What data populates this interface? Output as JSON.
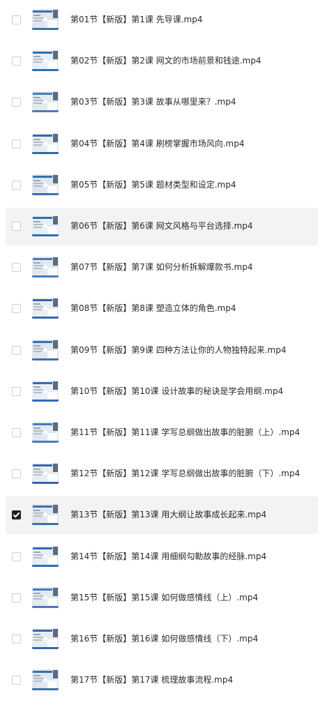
{
  "items": [
    {
      "title": "第01节【新版】第1课 先导课.mp4",
      "checked": false,
      "thumb_icon": "video-thumbnail-icon"
    },
    {
      "title": "第02节【新版】第2课 网文的市场前景和钱途.mp4",
      "checked": false,
      "thumb_icon": "video-thumbnail-icon"
    },
    {
      "title": "第03节【新版】第3课 故事从哪里来？.mp4",
      "checked": false,
      "thumb_icon": "video-thumbnail-icon"
    },
    {
      "title": "第04节【新版】第4课 刷榜掌握市场风向.mp4",
      "checked": false,
      "thumb_icon": "video-thumbnail-icon"
    },
    {
      "title": "第05节【新版】第5课 题材类型和设定.mp4",
      "checked": false,
      "thumb_icon": "video-thumbnail-icon"
    },
    {
      "title": "第06节【新版】第6课 网文风格与平台选择.mp4",
      "checked": false,
      "thumb_icon": "video-thumbnail-icon"
    },
    {
      "title": "第07节【新版】第7课 如何分析拆解爆款书.mp4",
      "checked": false,
      "thumb_icon": "video-thumbnail-icon"
    },
    {
      "title": "第08节【新版】第8课 塑造立体的角色.mp4",
      "checked": false,
      "thumb_icon": "video-thumbnail-icon"
    },
    {
      "title": "第09节【新版】第9课 四种方法让你的人物独特起来.mp4",
      "checked": false,
      "thumb_icon": "video-thumbnail-icon"
    },
    {
      "title": "第10节【新版】第10课 设计故事的秘诀是学会用纲.mp4",
      "checked": false,
      "thumb_icon": "video-thumbnail-icon"
    },
    {
      "title": "第11节【新版】第11课 学写总纲做出故事的脏腑（上）.mp4",
      "checked": false,
      "thumb_icon": "video-thumbnail-icon"
    },
    {
      "title": "第12节【新版】第12课 学写总纲做出故事的脏腑（下）.mp4",
      "checked": false,
      "thumb_icon": "video-thumbnail-icon"
    },
    {
      "title": "第13节【新版】第13课 用大纲让故事成长起来.mp4",
      "checked": true,
      "thumb_icon": "video-thumbnail-icon"
    },
    {
      "title": "第14节【新版】第14课 用细纲勾勒故事的经脉.mp4",
      "checked": false,
      "thumb_icon": "video-thumbnail-icon"
    },
    {
      "title": "第15节【新版】第15课 如何做感情线（上）.mp4",
      "checked": false,
      "thumb_icon": "video-thumbnail-icon"
    },
    {
      "title": "第16节【新版】第16课 如何做感情线（下）.mp4",
      "checked": false,
      "thumb_icon": "video-thumbnail-icon"
    },
    {
      "title": "第17节【新版】第17课 梳理故事流程.mp4",
      "checked": false,
      "thumb_icon": "video-thumbnail-icon"
    }
  ],
  "colors": {
    "row_highlight": "#f3f3f3",
    "checkbox_border": "#cfcfcf",
    "checkbox_checked": "#1e1e1e",
    "text": "#2b2b2b",
    "thumb_accent": "#2f6db5"
  }
}
